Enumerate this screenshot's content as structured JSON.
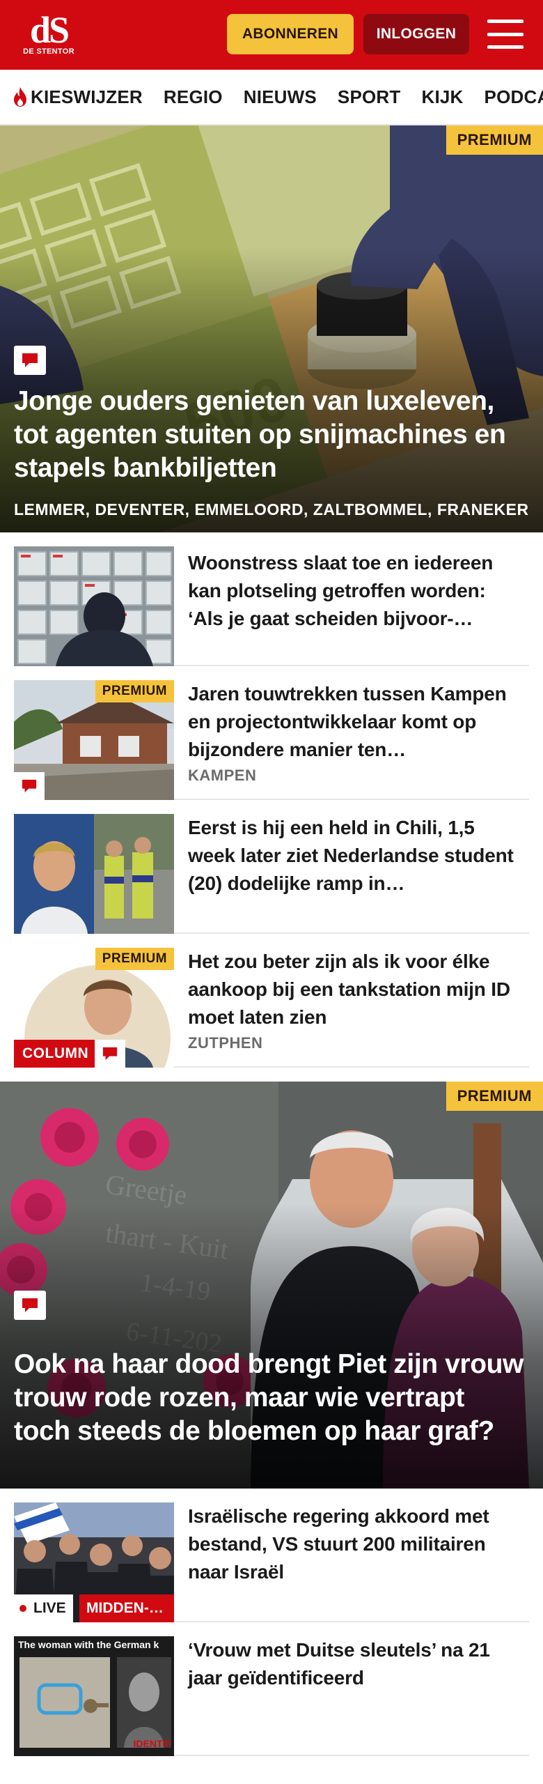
{
  "header": {
    "logo_mark": "dS",
    "logo_sub": "DE STENTOR",
    "subscribe_label": "ABONNEREN",
    "login_label": "INLOGGEN"
  },
  "nav": {
    "items": [
      "KIESWIJZER",
      "REGIO",
      "NIEUWS",
      "SPORT",
      "KIJK",
      "PODCASTS"
    ]
  },
  "articles": [
    {
      "kind": "hero",
      "premium": "PREMIUM",
      "title": "Jonge ouders genieten van luxeleven, tot agenten stuiten op snijmachines en stapels bankbiljetten",
      "locations": "LEMMER, DEVENTER, EMMELOORD, ZALTBOMMEL, FRANEKER"
    },
    {
      "kind": "item",
      "title": "Woonstress slaat toe en iedereen kan plotseling getroffen worden: ‘Als je gaat scheiden bijvoor-…"
    },
    {
      "kind": "item",
      "premium": "PREMIUM",
      "title": "Jaren touwtrekken tussen Kampen en projectontwikkelaar komt op bijzondere manier ten…",
      "location": "KAMPEN"
    },
    {
      "kind": "item",
      "title": "Eerst is hij een held in Chili, 1,5 week later ziet Nederlandse student (20) dodelijke ramp in…"
    },
    {
      "kind": "item",
      "premium": "PREMIUM",
      "tag": "COLUMN",
      "title": "Het zou beter zijn als ik voor élke aankoop bij een tankstation mijn ID moet laten zien",
      "location": "ZUTPHEN"
    },
    {
      "kind": "hero",
      "premium": "PREMIUM",
      "title": "Ook na haar dood brengt Piet zijn vrouw trouw rode rozen, maar wie vertrapt toch steeds de bloemen op haar graf?"
    },
    {
      "kind": "item",
      "live": "LIVE",
      "region": "MIDDEN-…",
      "title": "Israëlische regering akkoord met bestand, VS stuurt 200 militairen naar Israël"
    },
    {
      "kind": "item",
      "title": "‘Vrouw met Duitse sleutels’ na 21 jaar geïdentificeerd",
      "thumb_caption": "The woman with the German k",
      "thumb_stamp": "IDENTIF"
    }
  ],
  "colors": {
    "brand_red": "#d10a11",
    "premium_yellow": "#f5c33b",
    "login_dark_red": "#8e0a10"
  },
  "icons": [
    "flame-icon",
    "comment-icon",
    "hamburger-menu-icon",
    "live-dot-icon"
  ]
}
